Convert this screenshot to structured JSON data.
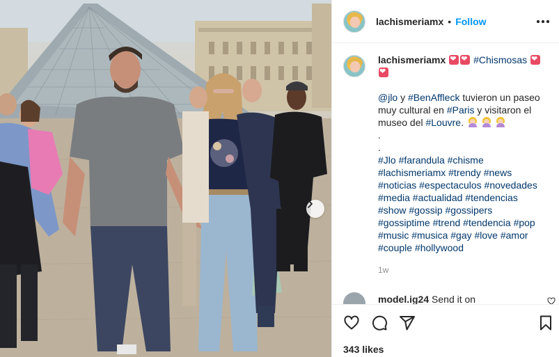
{
  "header": {
    "username": "lachismeriamx",
    "separator": "•",
    "follow_label": "Follow",
    "more_icon": "more-horizontal-icon"
  },
  "caption": {
    "username": "lachismeriamx",
    "hashtag_title": "#Chismosas",
    "mention": "@jlo",
    "text_1": " y ",
    "tag_ben": "#BenAffleck",
    "text_2": " tuvieron un paseo muy cultural en ",
    "tag_paris": "#Paris",
    "text_3": " y visitaron el museo del ",
    "tag_louvre": "#Louvre",
    "text_4": ".",
    "dot_1": ".",
    "dot_2": ".",
    "hashtags": "#Jlo #farandula #chisme #lachismeriamx #trendy #news #noticias #espectaculos #novedades #media #actualidad #tendencias #show #gossip #gossipers #gossiptime #trend #tendencia #pop #music #musica #gay #love #amor #couple #hollywood",
    "time": "1w"
  },
  "comment": {
    "username": "model.ig24",
    "text": " Send it on"
  },
  "actions": {
    "like_icon": "heart-icon",
    "comment_icon": "comment-icon",
    "share_icon": "share-icon",
    "save_icon": "bookmark-icon",
    "likes": "343 likes"
  },
  "colors": {
    "link": "#00376b",
    "follow": "#0095f6",
    "border": "#efefef"
  }
}
